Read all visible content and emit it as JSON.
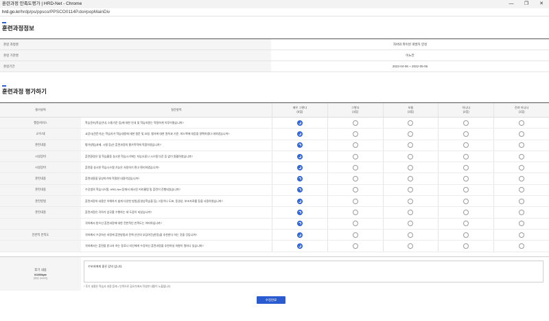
{
  "window": {
    "title": "훈련과정 만족도평가 | HRD-Net - Chrome",
    "url_host": "hrd.go.kr",
    "url_path": "/hrdp/ps/ppsco/PPSCO0114P.do#popMainDiv",
    "controls": [
      "—",
      "❐",
      "✕"
    ]
  },
  "info_section": {
    "title": "훈련과정정보",
    "rows": [
      {
        "label": "훈련 과정명",
        "value": "자바와 파이썬 개발자 양성"
      },
      {
        "label": "훈련 기관명",
        "value": "이노칸"
      },
      {
        "label": "훈련기간",
        "value": "2022-04-06 ~ 2022-05-06"
      }
    ]
  },
  "eval_section": {
    "title": "훈련과정 평가하기",
    "headers": {
      "area": "평가영역",
      "question": "질문항목",
      "options": [
        {
          "line1": "매우 그렇다",
          "line2": "(5점)"
        },
        {
          "line1": "그렇다",
          "line2": "(4점)"
        },
        {
          "line1": "보통",
          "line2": "(3점)"
        },
        {
          "line1": "아니다",
          "line2": "(2점)"
        },
        {
          "line1": "전혀 아니다",
          "line2": "(1점)"
        }
      ]
    },
    "rows": [
      {
        "area": "행정서비스",
        "question": "학습준비(학습안내, 소통기준 등)에 대한 안내 및 학습지원는 적절하게 이루어졌습니까?",
        "selected": 0
      },
      {
        "area": "교수/내",
        "question": "교강사(전문가)는 학습자가 학습내용에 대한 질문 및 요청, 평가에 대한 원칙과 기준, 피드백에 대응을 명확하였다 대하였습니까?",
        "selected": 0
      },
      {
        "area": "훈련내용",
        "question": "평가방법(과제, 시험 등)은 훈련과정의 평가목적에 적합하였습니까?",
        "selected": 0
      },
      {
        "area": "시설장비",
        "question": "훈련환경은 및 학습활동 실시한 학습시기에는 지능오류나 시스템 다운 등 없이 원활하였습니까?",
        "selected": 0
      },
      {
        "area": "시설장비",
        "question": "훈련을 실시한 학습시스템 기능은 사용하기 편고 편리하였습니까?",
        "selected": 0
      },
      {
        "area": "훈련내용",
        "question": "훈련내용을 달성하기에 적절한 내용이었습니까?",
        "selected": 0
      },
      {
        "area": "훈련내용",
        "question": "수강생의 학습시스템, HRD-Net 등에서 제시된 커리큘럼 및 훈련이 진행되었습니까?",
        "selected": 0
      },
      {
        "area": "훈련방법",
        "question": "훈련과정의 내용은 이해하기 쉽게 다양한 방법(동영상학습을 등) 그림이나 도표, 동영상, 보조자료를 등을 사용하였습니까?",
        "selected": 0
      },
      {
        "area": "훈련내용",
        "question": "훈련과정은 귀하가 업무를 수행하는 데 도움이 되었습니까?",
        "selected": 0
      },
      {
        "area": "",
        "question": "귀하께서 받으신 훈련과정에 대한 전반적인 만족도는 어떠하십니까?",
        "selected": 0
      },
      {
        "area": "전반적 만족도",
        "question": "귀하께서 수강하신 과정에 훈련방법과 전액 선인의 부담여건(한정)을 추천한다 하는 것을 것입니까?",
        "selected": 0
      },
      {
        "area": "",
        "question": "귀하께서는 훈련을 받고자 하는 동료나 지인에게 수강하신 훈련과정을 추천하실 의향이 얼마나 있습니까?",
        "selected": 0
      }
    ]
  },
  "review": {
    "label": "후기 내용",
    "count": "0/1000byte",
    "max": "(최대 1000자)",
    "text": "수보자에게 좋은 강의 입니다",
    "note": "* 후기 내용은 학습사 과정 등에 • 인력으로 공유가에서 작성한 내용이 노출됩니다."
  },
  "submit_label": "수정완료",
  "colors": {
    "accent": "#2d5fd4",
    "button": "#2a5bd0"
  }
}
